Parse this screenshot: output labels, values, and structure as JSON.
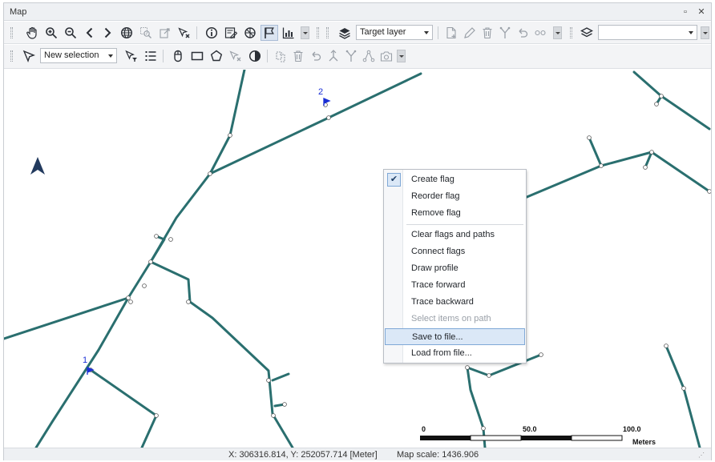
{
  "window": {
    "title": "Map",
    "minimize_glyph": "▫",
    "close_glyph": "✕"
  },
  "toolbar1": {
    "tools": [
      "pan-hand-icon",
      "zoom-in-icon",
      "zoom-out-icon",
      "back-icon",
      "forward-icon",
      "full-extent-globe-icon",
      "zoom-selection-icon",
      "identify-pointer-icon",
      "clear-selection-icon",
      "info-icon",
      "attributes-icon",
      "network-icon",
      "flag-icon",
      "chart-icon"
    ],
    "target_layer_value": "Target layer",
    "layer_combo_value": ""
  },
  "toolbar2": {
    "selection_mode_value": "New selection"
  },
  "context_menu": {
    "items": [
      {
        "label": "Create flag",
        "checked": true
      },
      {
        "label": "Reorder flag"
      },
      {
        "label": "Remove flag"
      },
      {
        "label": "Clear flags and paths"
      },
      {
        "label": "Connect flags"
      },
      {
        "label": "Draw profile"
      },
      {
        "label": "Trace forward"
      },
      {
        "label": "Trace backward"
      },
      {
        "label": "Select items on path",
        "disabled": true
      },
      {
        "label": "Save to file...",
        "highlighted": true
      },
      {
        "label": "Load from file..."
      }
    ],
    "check_glyph": "✔"
  },
  "map": {
    "flag_labels": [
      "1",
      "2"
    ],
    "network_color": "#2a6f6f",
    "flag_color": "#1a2fd6",
    "scale": {
      "label_0": "0",
      "label_mid": "50.0",
      "label_max": "100.0",
      "units": "Meters"
    }
  },
  "status": {
    "coordinates": "X: 306316.814, Y: 252057.714 [Meter]",
    "map_scale": "Map scale: 1436.906"
  }
}
